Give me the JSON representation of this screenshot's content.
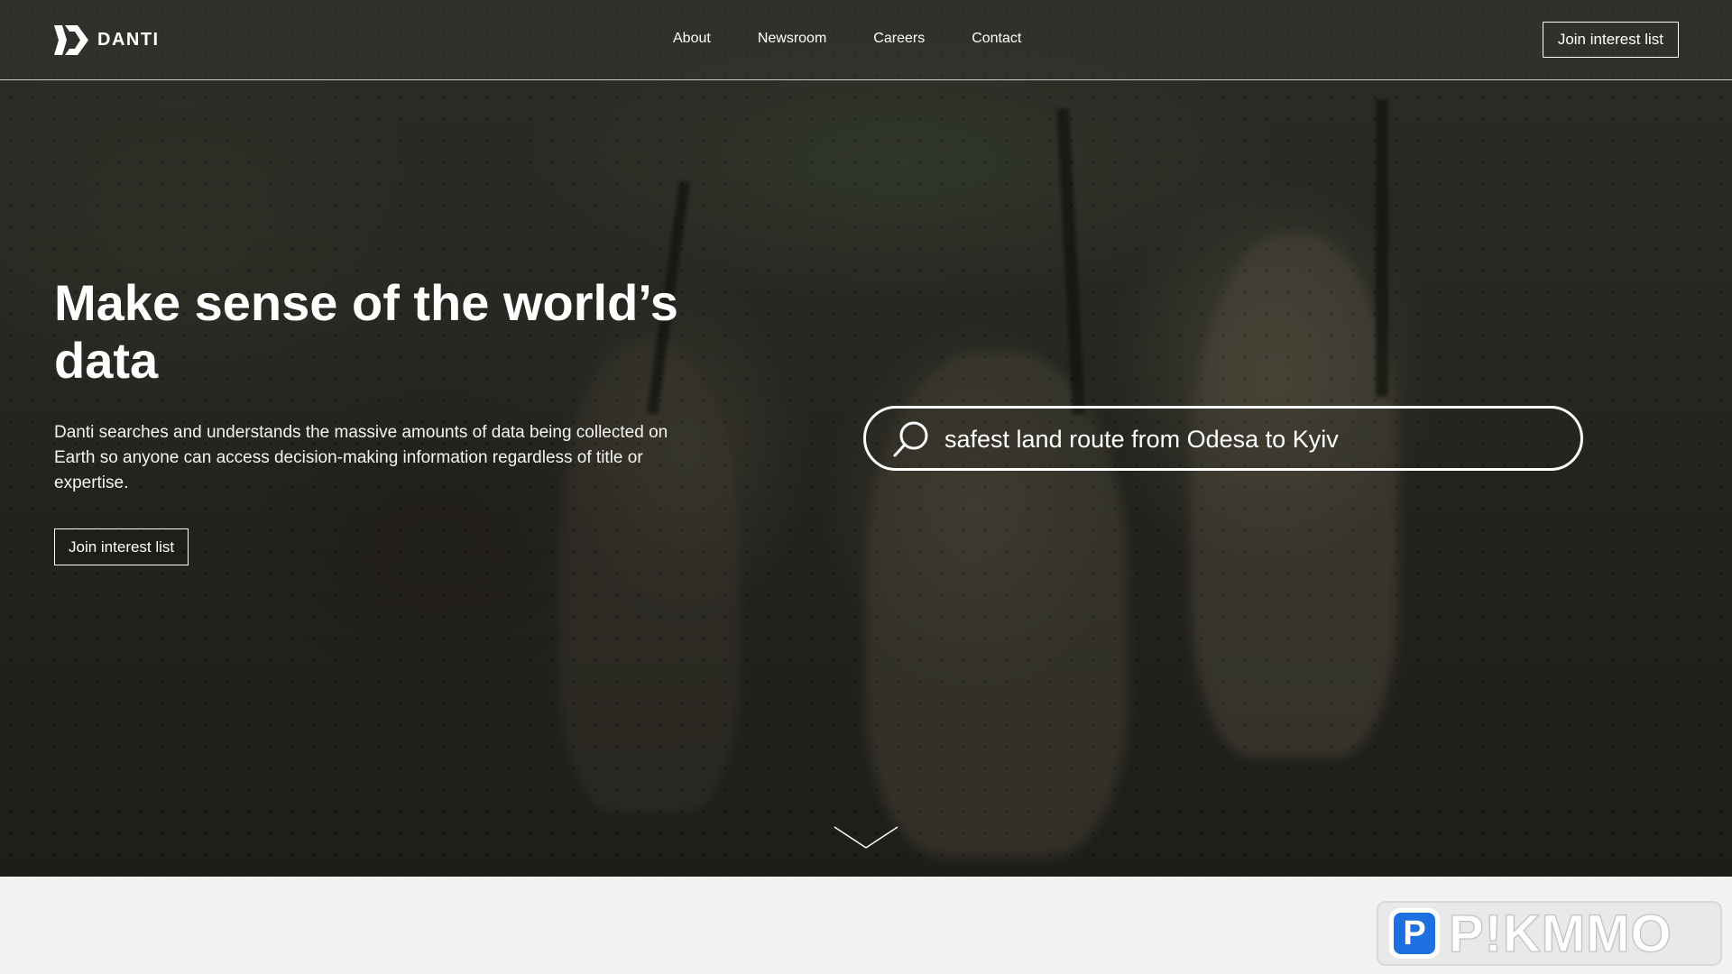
{
  "header": {
    "brand": "DANTI",
    "nav": [
      "About",
      "Newsroom",
      "Careers",
      "Contact"
    ],
    "cta_label": "Join interest list"
  },
  "hero": {
    "headline": "Make sense of the world’s data",
    "description": "Danti searches and understands the massive amounts of data being collected on Earth so anyone can access decision-making information regardless of title or expertise.",
    "cta_label": "Join interest list"
  },
  "search": {
    "query": "safest land route from Odesa to Kyiv"
  },
  "watermark": {
    "badge_letter": "P",
    "text": "P!KMMO"
  },
  "colors": {
    "accent_blue": "#1e6fe0",
    "lower_background": "#f2f3f0"
  },
  "icons": [
    "danti-logo-icon",
    "search-icon",
    "chevron-down-icon"
  ]
}
